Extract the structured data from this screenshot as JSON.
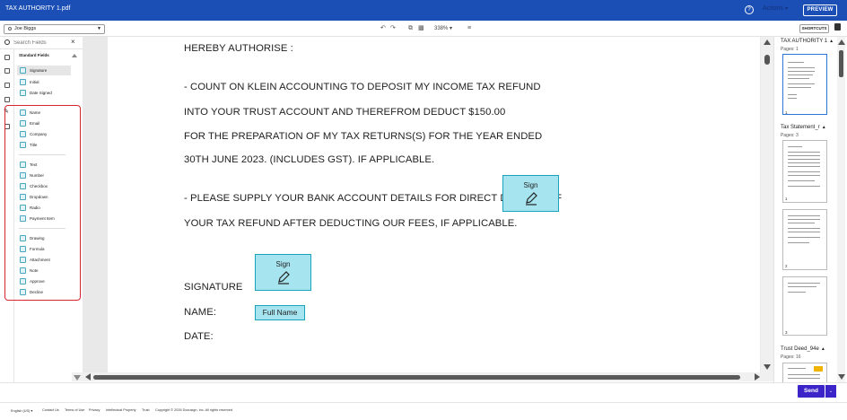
{
  "app": {
    "doc_title": "TAX AUTHORITY 1.pdf",
    "help_icon": "help-icon",
    "actions_label": "Actions",
    "preview_label": "PREVIEW",
    "accent_color": "#1b4fb6",
    "field_color": "#a6e4f0",
    "send_color": "#3b25c9",
    "highlight_color": "#d7262f"
  },
  "toolbar": {
    "recipient": "Joe Biggs",
    "zoom": "338%",
    "shortcuts_label": "SHORTCUTS"
  },
  "search": {
    "placeholder": "Search Fields"
  },
  "fields": {
    "section_title": "Standard Fields",
    "group1": [
      "Signature",
      "Initial",
      "Date Signed"
    ],
    "group2": [
      "Name",
      "Email",
      "Company",
      "Title"
    ],
    "group3": [
      "Text",
      "Number",
      "Checkbox",
      "Dropdown",
      "Radio",
      "Payment Item"
    ],
    "group4": [
      "Drawing",
      "Formula",
      "Attachment",
      "Note",
      "Approve",
      "Decline"
    ]
  },
  "document": {
    "lines": [
      "HEREBY AUTHORISE :",
      "- COUNT ON KLEIN ACCOUNTING TO DEPOSIT MY INCOME TAX REFUND",
      "INTO YOUR TRUST ACCOUNT AND THEREFROM DEDUCT $150.00",
      "FOR THE PREPARATION OF MY TAX RETURNS(S) FOR THE YEAR ENDED",
      "30TH JUNE 2023. (INCLUDES GST). IF APPLICABLE.",
      "- PLEASE SUPPLY YOUR BANK ACCOUNT DETAILS FOR DIRECT DEPOSIT OF",
      "YOUR TAX REFUND AFTER DEDUCTING OUR FEES, IF APPLICABLE.",
      "SIGNATURE",
      "NAME:",
      "DATE:"
    ],
    "sign_label": "Sign",
    "full_name_label": "Full Name"
  },
  "thumbnails": {
    "docs": [
      {
        "name": "TAX AUTHORITY 1",
        "pages": "Pages: 1",
        "page_nums": [
          "1"
        ]
      },
      {
        "name": "Tax Statement_r",
        "pages": "Pages: 3",
        "page_nums": [
          "1",
          "2",
          "3"
        ]
      },
      {
        "name": "Trust Deed_94e",
        "pages": "Pages: 16",
        "page_nums": []
      }
    ]
  },
  "bottom": {
    "send_label": "Send"
  },
  "footer": {
    "language": "English (US)",
    "links": [
      "Contact Us",
      "Terms of Use",
      "Privacy",
      "Intellectual Property",
      "Trust",
      "Copyright © 2026 Docusign, Inc. All rights reserved"
    ]
  }
}
